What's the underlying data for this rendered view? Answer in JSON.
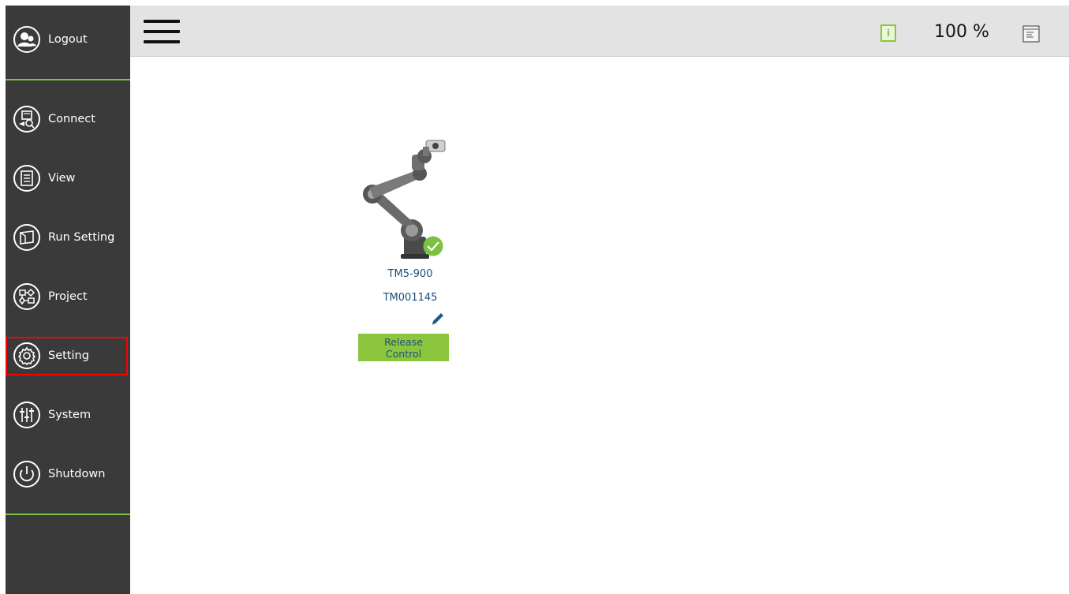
{
  "sidebar": {
    "items": [
      {
        "label": "Logout",
        "icon": "user-icon"
      },
      {
        "label": "Connect",
        "icon": "connect-icon"
      },
      {
        "label": "View",
        "icon": "view-icon"
      },
      {
        "label": "Run Setting",
        "icon": "run-setting-icon"
      },
      {
        "label": "Project",
        "icon": "project-icon"
      },
      {
        "label": "Setting",
        "icon": "gear-icon"
      },
      {
        "label": "System",
        "icon": "sliders-icon"
      },
      {
        "label": "Shutdown",
        "icon": "power-icon"
      }
    ],
    "selected": "Setting",
    "accent_color": "#7cc242",
    "highlight_color": "#ff0000"
  },
  "topbar": {
    "zoom": "100 %",
    "info_icon_text": "i"
  },
  "robot": {
    "model": "TM5-900",
    "serial": "TM001145",
    "status_icon": "check-icon",
    "release_label": "Release\nControl"
  }
}
